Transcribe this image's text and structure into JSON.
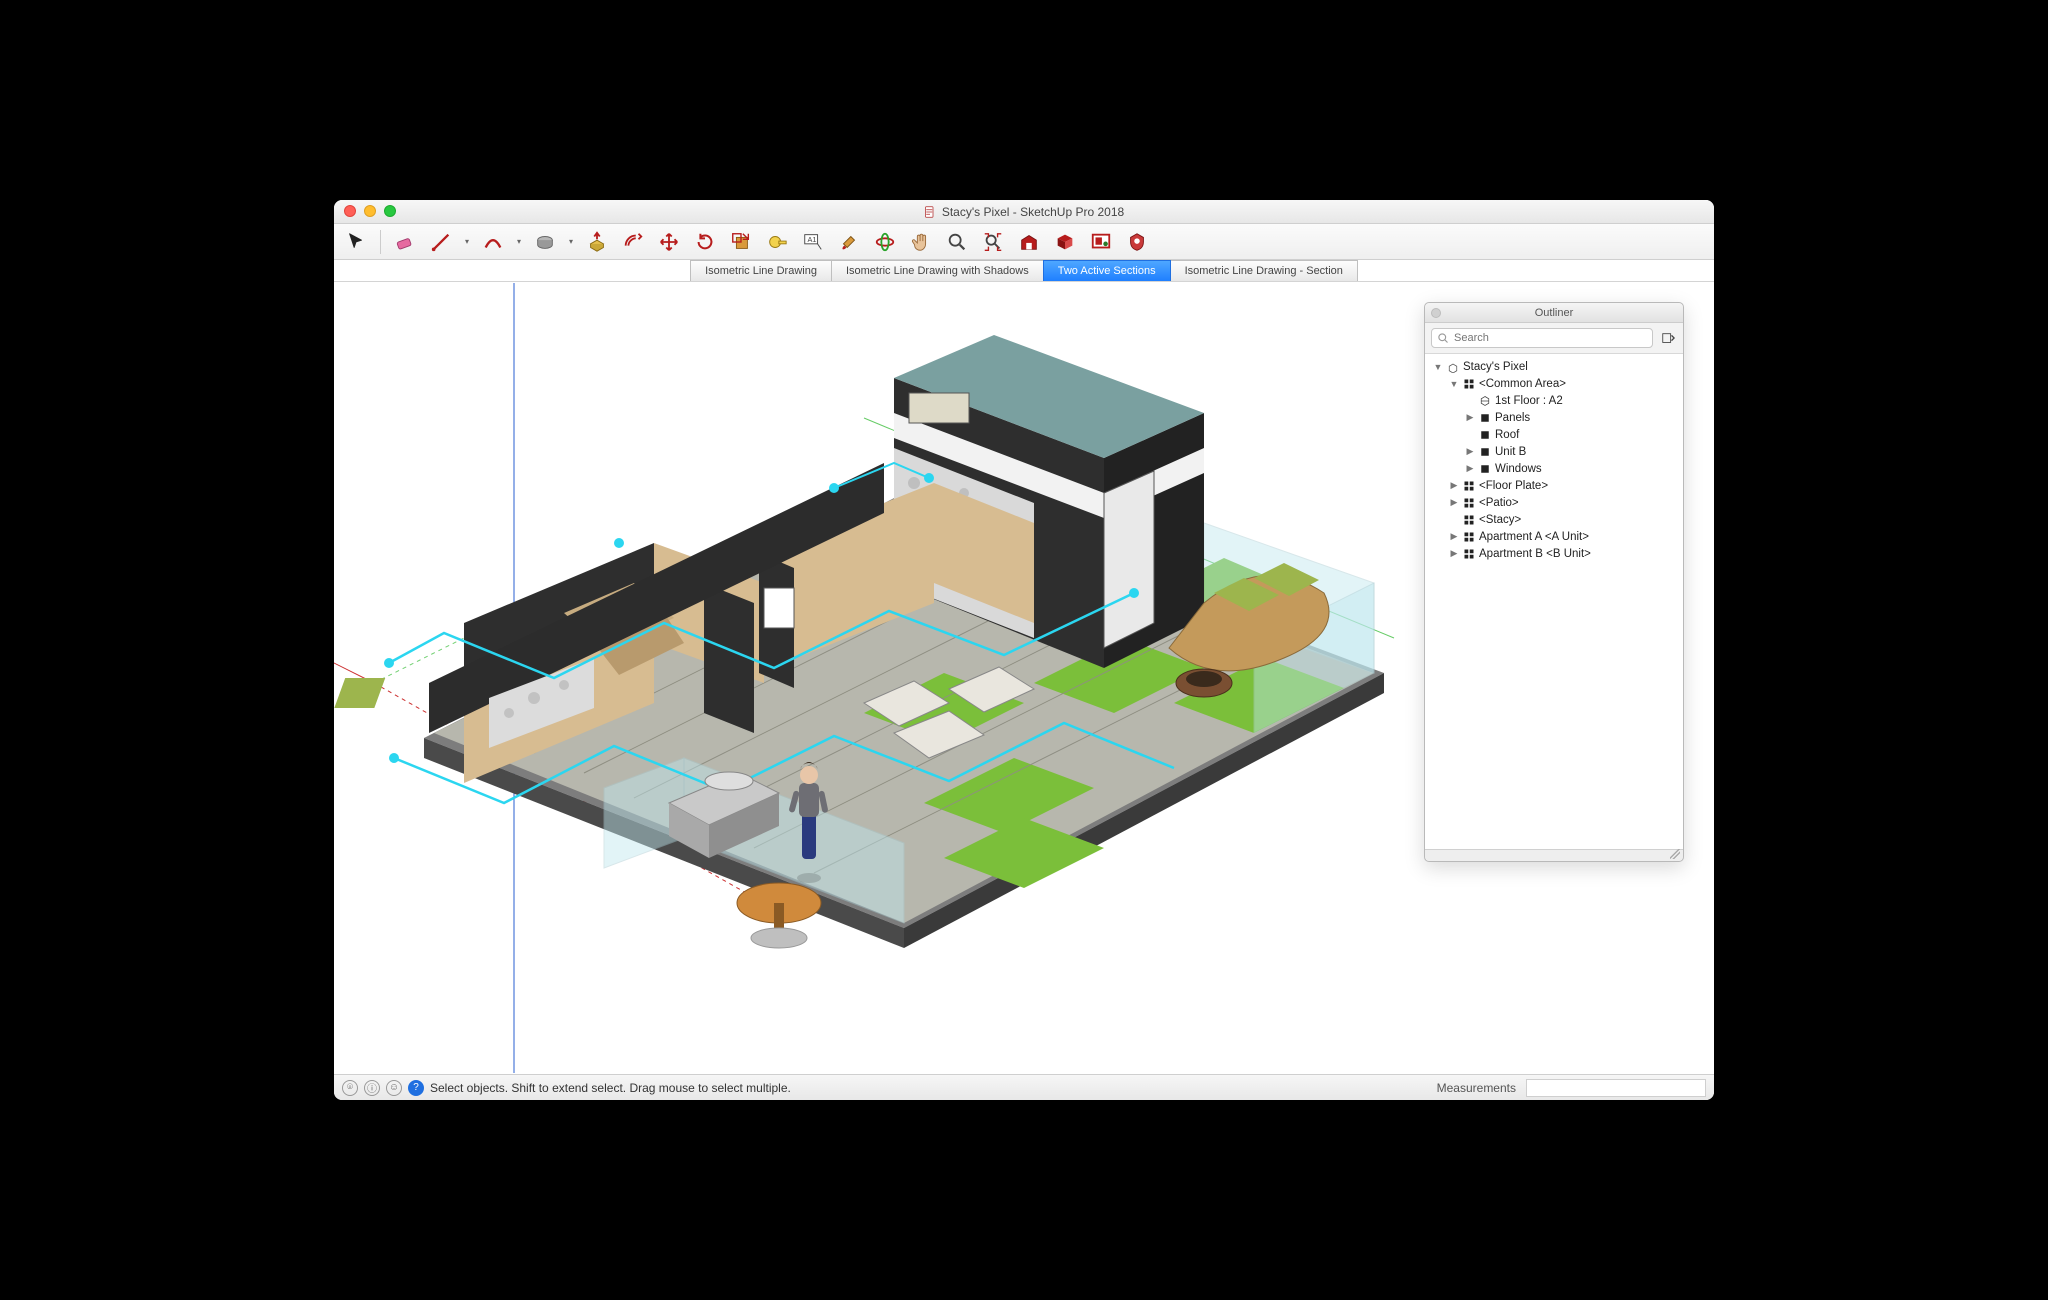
{
  "window": {
    "title": "Stacy's Pixel - SketchUp Pro 2018"
  },
  "toolbar_tools": [
    {
      "name": "select",
      "color": "#222"
    },
    {
      "name": "eraser",
      "color": "#d0547c"
    },
    {
      "name": "line",
      "color": "#b71c1c"
    },
    {
      "name": "arc",
      "color": "#b71c1c"
    },
    {
      "name": "shapes",
      "color": "#8a8a8a"
    },
    {
      "name": "pushpull",
      "color": "#c9a218"
    },
    {
      "name": "offset",
      "color": "#b71c1c"
    },
    {
      "name": "move",
      "color": "#b71c1c"
    },
    {
      "name": "rotate",
      "color": "#b71c1c"
    },
    {
      "name": "scale",
      "color": "#b71c1c"
    },
    {
      "name": "tape",
      "color": "#c9a218"
    },
    {
      "name": "text",
      "color": "#444"
    },
    {
      "name": "paint",
      "color": "#b71c1c"
    },
    {
      "name": "orbit",
      "color": "#b71c1c"
    },
    {
      "name": "pan",
      "color": "#d9a25a"
    },
    {
      "name": "zoom",
      "color": "#444"
    },
    {
      "name": "zoomextents",
      "color": "#b71c1c"
    },
    {
      "name": "warehouse",
      "color": "#b71c1c"
    },
    {
      "name": "components",
      "color": "#b71c1c"
    },
    {
      "name": "layout",
      "color": "#b71c1c"
    },
    {
      "name": "extensions",
      "color": "#b71c1c"
    }
  ],
  "scene_tabs": [
    {
      "label": "Isometric Line Drawing",
      "active": false
    },
    {
      "label": "Isometric Line Drawing with Shadows",
      "active": false
    },
    {
      "label": "Two Active Sections",
      "active": true
    },
    {
      "label": "Isometric Line Drawing - Section",
      "active": false
    }
  ],
  "outliner": {
    "title": "Outliner",
    "search_placeholder": "Search",
    "tree": [
      {
        "depth": 0,
        "disclosure": "down",
        "icon": "model",
        "label": "Stacy's Pixel"
      },
      {
        "depth": 1,
        "disclosure": "down",
        "icon": "comp",
        "label": "<Common Area>"
      },
      {
        "depth": 2,
        "disclosure": "none",
        "icon": "section",
        "label": "1st Floor : A2"
      },
      {
        "depth": 2,
        "disclosure": "right",
        "icon": "group",
        "label": "Panels"
      },
      {
        "depth": 2,
        "disclosure": "none",
        "icon": "group",
        "label": "Roof"
      },
      {
        "depth": 2,
        "disclosure": "right",
        "icon": "group",
        "label": "Unit B"
      },
      {
        "depth": 2,
        "disclosure": "right",
        "icon": "group",
        "label": "Windows"
      },
      {
        "depth": 1,
        "disclosure": "right",
        "icon": "comp",
        "label": "<Floor Plate>"
      },
      {
        "depth": 1,
        "disclosure": "right",
        "icon": "comp",
        "label": "<Patio>"
      },
      {
        "depth": 1,
        "disclosure": "none",
        "icon": "comp",
        "label": "<Stacy>"
      },
      {
        "depth": 1,
        "disclosure": "right",
        "icon": "comp",
        "label": "Apartment A <A Unit>"
      },
      {
        "depth": 1,
        "disclosure": "right",
        "icon": "comp",
        "label": "Apartment B <B Unit>"
      }
    ]
  },
  "status": {
    "hint": "Select objects. Shift to extend select. Drag mouse to select multiple.",
    "measurements_label": "Measurements",
    "measurements_value": ""
  }
}
